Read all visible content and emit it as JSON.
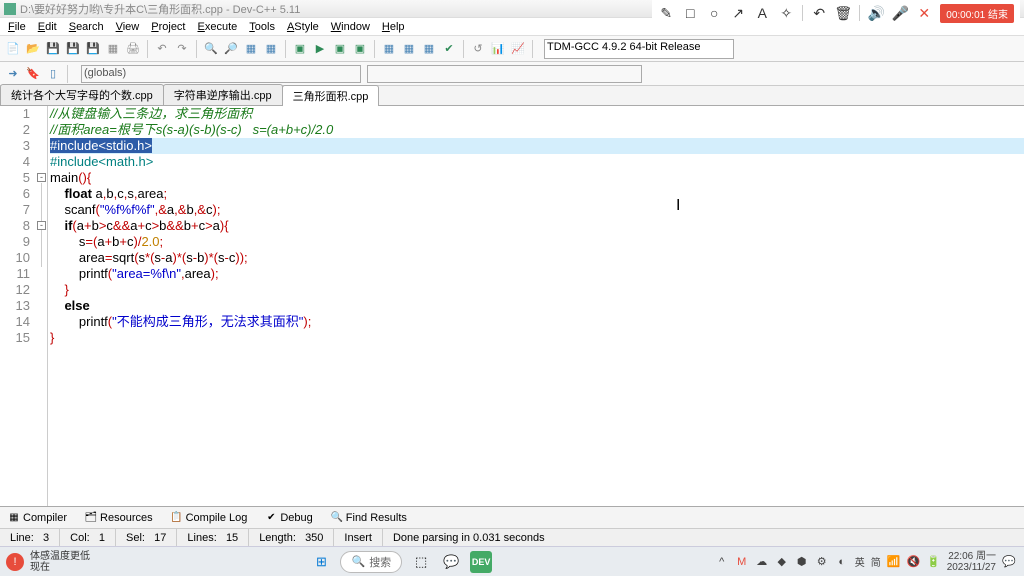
{
  "title": "D:\\要好好努力哟\\专升本C\\三角形面积.cpp - Dev-C++ 5.11",
  "menu": [
    "File",
    "Edit",
    "Search",
    "View",
    "Project",
    "Execute",
    "Tools",
    "AStyle",
    "Window",
    "Help"
  ],
  "recorder": "00:00:01 结束",
  "compiler": "TDM-GCC 4.9.2 64-bit Release",
  "scope": "(globals)",
  "tabs": [
    {
      "label": "统计各个大写字母的个数.cpp",
      "active": false
    },
    {
      "label": "字符串逆序输出.cpp",
      "active": false
    },
    {
      "label": "三角形面积.cpp",
      "active": true
    }
  ],
  "code": {
    "lines": [
      {
        "n": "1",
        "t": "comment",
        "text": "//从键盘输入三条边，求三角形面积"
      },
      {
        "n": "2",
        "t": "comment",
        "text": "//面积area=根号下s(s-a)(s-b)(s-c)   s=(a+b+c)/2.0"
      },
      {
        "n": "3",
        "t": "include_sel",
        "text": "#include<stdio.h>"
      },
      {
        "n": "4",
        "t": "include",
        "text": "#include<math.h>"
      },
      {
        "n": "5",
        "t": "main",
        "text": "main(){"
      },
      {
        "n": "6",
        "t": "decl",
        "text": "    float a,b,c,s,area;"
      },
      {
        "n": "7",
        "t": "scanf",
        "text": "    scanf(\"%f%f%f\",&a,&b,&c);"
      },
      {
        "n": "8",
        "t": "if",
        "text": "    if(a+b>c&&a+c>b&&b+c>a){"
      },
      {
        "n": "9",
        "t": "assign",
        "text": "        s=(a+b+c)/2.0;"
      },
      {
        "n": "10",
        "t": "sqrt",
        "text": "        area=sqrt(s*(s-a)*(s-b)*(s-c));"
      },
      {
        "n": "11",
        "t": "printf1",
        "text": "        printf(\"area=%f\\n\",area);"
      },
      {
        "n": "12",
        "t": "brace",
        "text": "    }"
      },
      {
        "n": "13",
        "t": "else",
        "text": "    else"
      },
      {
        "n": "14",
        "t": "printf2",
        "text": "        printf(\"不能构成三角形，无法求其面积\");"
      },
      {
        "n": "15",
        "t": "brace",
        "text": "}"
      }
    ]
  },
  "bottom_tabs": [
    "Compiler",
    "Resources",
    "Compile Log",
    "Debug",
    "Find Results"
  ],
  "status": {
    "line_label": "Line:",
    "line": "3",
    "col_label": "Col:",
    "col": "1",
    "sel_label": "Sel:",
    "sel": "17",
    "lines_label": "Lines:",
    "lines": "15",
    "length_label": "Length:",
    "length": "350",
    "ins": "Insert",
    "parse": "Done parsing in 0.031 seconds"
  },
  "taskbar": {
    "weather_title": "体感温度更低",
    "weather_sub": "现在",
    "search": "搜索",
    "lang": "英",
    "ime": "简",
    "time": "22:06 周一",
    "date": "2023/11/27"
  }
}
